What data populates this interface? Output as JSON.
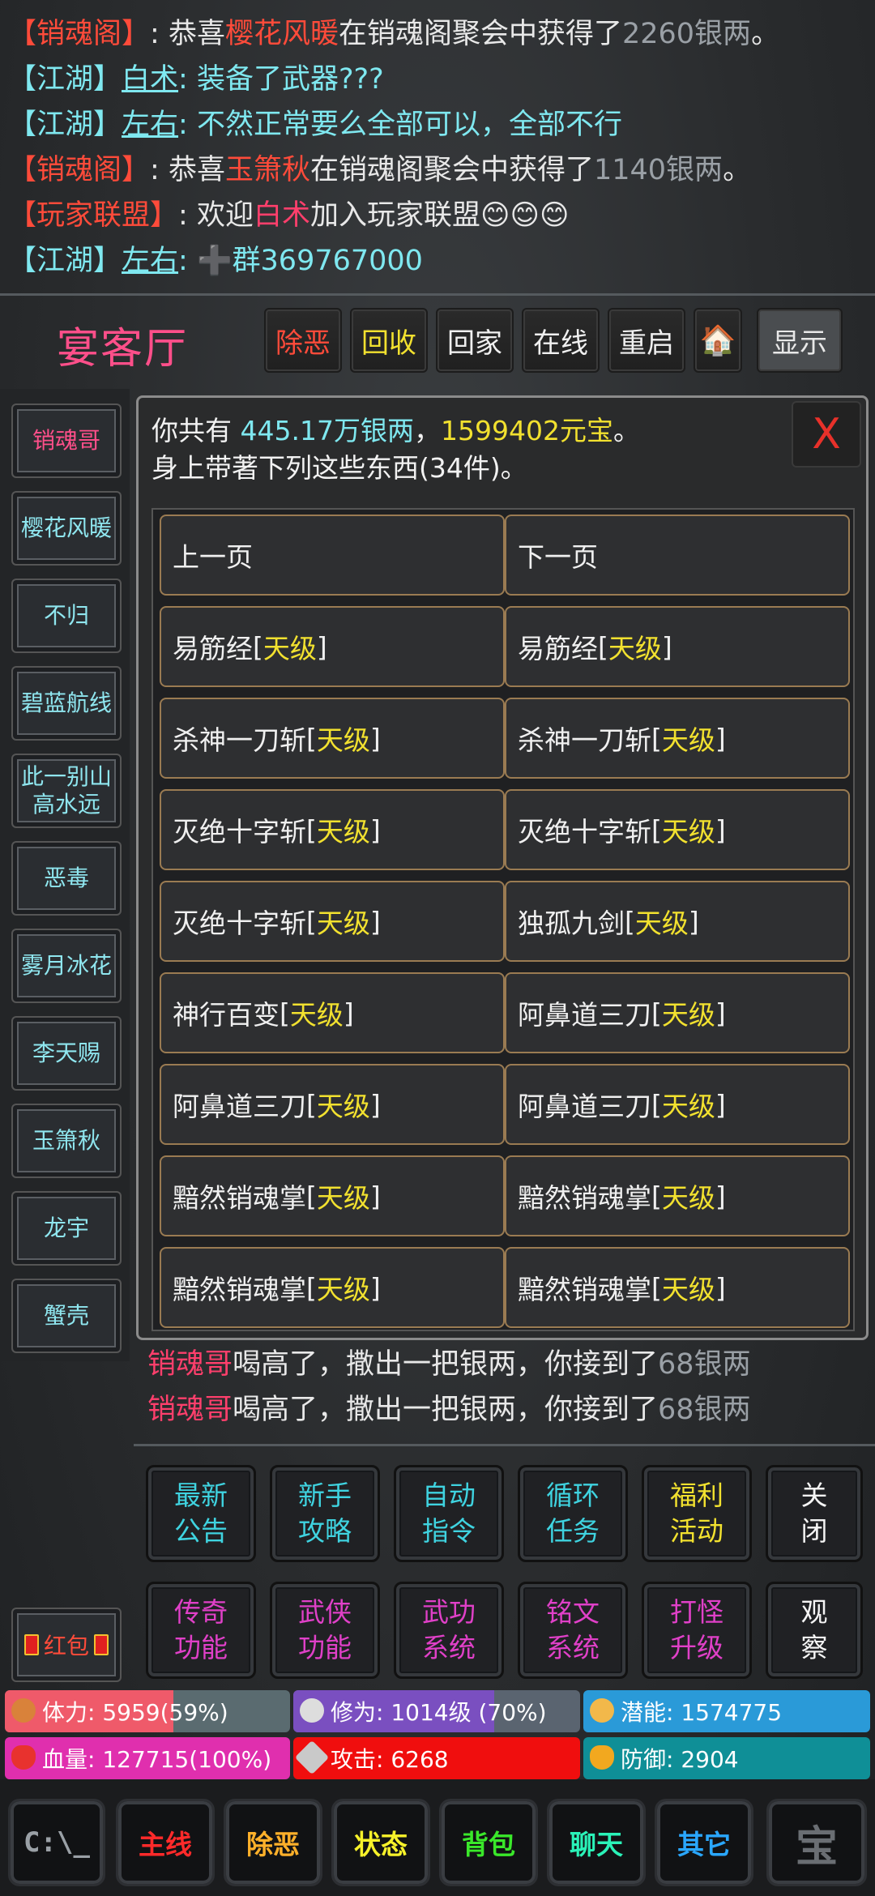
{
  "chat": {
    "line1": {
      "channel": "【销魂阁】",
      "colon": ":",
      "a": " 恭喜",
      "name": "樱花风暖",
      "b": "在销魂阁聚会中获得了",
      "amount": "2260银两",
      "c": "。"
    },
    "line2": {
      "channel": "【江湖】",
      "user": "白术",
      "text": ": 装备了武器???"
    },
    "line3": {
      "channel": "【江湖】",
      "user": "左右",
      "text": ": 不然正常要么全部可以，全部不行"
    },
    "line4": {
      "channel": "【销魂阁】",
      "colon": ":",
      "a": " 恭喜",
      "name": "玉箫秋",
      "b": "在销魂阁聚会中获得了",
      "amount": "1140银两",
      "c": "。"
    },
    "line5": {
      "channel": "【玩家联盟】",
      "colon": ":",
      "a": " 欢迎",
      "name": "白术",
      "b": "加入玩家联盟",
      "emoji": "😊😊😊"
    },
    "line6": {
      "channel": "【江湖】",
      "user": "左右",
      "text": ": ➕群369767000"
    }
  },
  "header": {
    "title": "宴客厅"
  },
  "topbar": {
    "buttons": [
      "除恶",
      "回收",
      "回家",
      "在线",
      "重启",
      "显示"
    ],
    "home_icon": "🏠"
  },
  "sidebar": {
    "items": [
      "销魂哥",
      "樱花风暖",
      "不归",
      "碧蓝航线",
      "此一别山高水远",
      "恶毒",
      "雾月冰花",
      "李天赐",
      "玉箫秋",
      "龙宇",
      "蟹壳"
    ]
  },
  "panel": {
    "info_prefix": "你共有 ",
    "silver": "445.17万银两",
    "comma": "，",
    "gold": "1599402元宝",
    "period": "。",
    "line2": "身上带著下列这些东西(34件)。",
    "close_label": "X",
    "prev": "上一页",
    "next": "下一页",
    "items": [
      {
        "name": "易筋经",
        "level": "天级"
      },
      {
        "name": "易筋经",
        "level": "天级"
      },
      {
        "name": "杀神一刀斩",
        "level": "天级"
      },
      {
        "name": "杀神一刀斩",
        "level": "天级"
      },
      {
        "name": "灭绝十字斩",
        "level": "天级"
      },
      {
        "name": "灭绝十字斩",
        "level": "天级"
      },
      {
        "name": "灭绝十字斩",
        "level": "天级"
      },
      {
        "name": "独孤九剑",
        "level": "天级"
      },
      {
        "name": "神行百变",
        "level": "天级"
      },
      {
        "name": "阿鼻道三刀",
        "level": "天级"
      },
      {
        "name": "阿鼻道三刀",
        "level": "天级"
      },
      {
        "name": "阿鼻道三刀",
        "level": "天级"
      },
      {
        "name": "黯然销魂掌",
        "level": "天级"
      },
      {
        "name": "黯然销魂掌",
        "level": "天级"
      },
      {
        "name": "黯然销魂掌",
        "level": "天级"
      },
      {
        "name": "黯然销魂掌",
        "level": "天级"
      }
    ]
  },
  "messages": [
    {
      "name": "销魂哥",
      "text": "喝高了，撒出一把银两，你接到了",
      "amount": "68银两"
    },
    {
      "name": "销魂哥",
      "text": "喝高了，撒出一把银两，你接到了",
      "amount": "68银两"
    }
  ],
  "functions": {
    "row1": [
      {
        "l1": "最新",
        "l2": "公告"
      },
      {
        "l1": "新手",
        "l2": "攻略"
      },
      {
        "l1": "自动",
        "l2": "指令"
      },
      {
        "l1": "循环",
        "l2": "任务"
      },
      {
        "l1": "福利",
        "l2": "活动"
      },
      {
        "l1": "关",
        "l2": "闭"
      }
    ],
    "row2": [
      {
        "l1": "传奇",
        "l2": "功能"
      },
      {
        "l1": "武侠",
        "l2": "功能"
      },
      {
        "l1": "武功",
        "l2": "系统"
      },
      {
        "l1": "铭文",
        "l2": "系统"
      },
      {
        "l1": "打怪",
        "l2": "升级"
      },
      {
        "l1": "观",
        "l2": "察"
      }
    ]
  },
  "red_packet": "红包",
  "stats": {
    "stamina": {
      "label": "体力: 5959(59%)",
      "percent": 59
    },
    "cultivation": {
      "label": "修为: 1014级 (70%)",
      "percent": 70
    },
    "potential": {
      "label": "潜能: 1574775"
    },
    "hp": {
      "label": "血量: 127715(100%)",
      "percent": 100
    },
    "attack": {
      "label": "攻击: 6268"
    },
    "defense": {
      "label": "防御: 2904"
    }
  },
  "nav": {
    "terminal": "C:\\_",
    "items": [
      "主线",
      "除恶",
      "状态",
      "背包",
      "聊天",
      "其它"
    ],
    "last_icon": "宝"
  }
}
